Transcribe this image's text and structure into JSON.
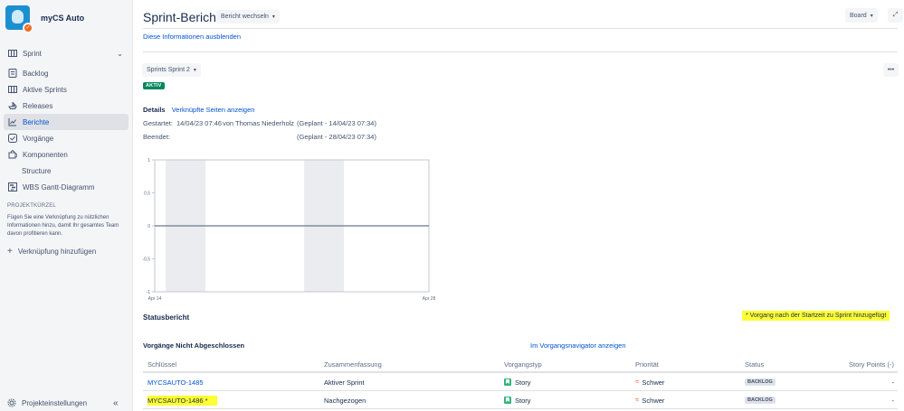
{
  "project": {
    "name": "myCS Auto"
  },
  "sidebar": {
    "group_label": "Sprint",
    "items": [
      {
        "label": "Backlog",
        "icon": "backlog-icon"
      },
      {
        "label": "Aktive Sprints",
        "icon": "board-icon"
      },
      {
        "label": "Releases",
        "icon": "ship-icon"
      },
      {
        "label": "Berichte",
        "icon": "chart-icon",
        "active": true
      },
      {
        "label": "Vorgänge",
        "icon": "issues-icon"
      },
      {
        "label": "Komponenten",
        "icon": "puzzle-icon"
      },
      {
        "label": "Structure",
        "icon": ""
      },
      {
        "label": "WBS Gantt-Diagramm",
        "icon": "gantt-icon"
      }
    ],
    "shortcuts_title": "PROJEKTKÜRZEL",
    "shortcuts_text": "Fügen Sie eine Verknüpfung zu nützlichen Informationen hinzu, damit Ihr gesamtes Team davon profitieren kann.",
    "add_shortcut": "Verknüpfung hinzufügen",
    "settings": "Projekteinstellungen",
    "collapse": "«"
  },
  "header": {
    "title": "Sprint-Bericht",
    "switch_report": "Bericht wechseln",
    "board": "Board"
  },
  "info": {
    "hide": "Diese Informationen ausblenden"
  },
  "sprint": {
    "selector": "Sprints Sprint 2",
    "status": "AKTIV",
    "details_label": "Details",
    "linked_pages": "Verknüpfte Seiten anzeigen",
    "started_label": "Gestartet:",
    "started_value": "14/04/23 07:46",
    "by": "von",
    "user": "Thomas Niederholz",
    "started_planned": "(Geplant - 14/04/23 07:34)",
    "ended_label": "Beendet:",
    "ended_planned": "(Geplant - 28/04/23 07:34)"
  },
  "chart_data": {
    "type": "line",
    "x": [
      "Apr 14",
      "Apr 28"
    ],
    "y_ticks": [
      "1",
      "0,5",
      "0",
      "-0,5",
      "-1"
    ],
    "ylim": [
      -1,
      1
    ],
    "series": [
      {
        "values": [
          0,
          0
        ]
      }
    ],
    "xlabel": "",
    "ylabel": "",
    "title": ""
  },
  "status_report": {
    "title": "Statusbericht",
    "note": "* Vorgang nach der Startzeit zu Sprint hinzugefügt"
  },
  "open_issues": {
    "title": "Vorgänge Nicht Abgeschlossen",
    "navigator_link": "Im Vorgangsnavigator anzeigen",
    "columns": [
      "Schlüssel",
      "Zusammenfassung",
      "Vorgangstyp",
      "Priorität",
      "Status",
      "Story Points (-)"
    ],
    "rows": [
      {
        "key": "MYCSAUTO-1485",
        "summary": "Aktiver Sprint",
        "type": "Story",
        "priority": "Schwer",
        "status": "BACKLOG",
        "points": "-"
      },
      {
        "key": "MYCSAUTO-1486 *",
        "summary": "Nachgezogen",
        "type": "Story",
        "priority": "Schwer",
        "status": "BACKLOG",
        "points": "-"
      }
    ]
  },
  "colors": {
    "accent": "#0052cc",
    "active_badge": "#00875a",
    "highlight": "#ffff33",
    "sidebar_bg": "#f4f5f7"
  }
}
